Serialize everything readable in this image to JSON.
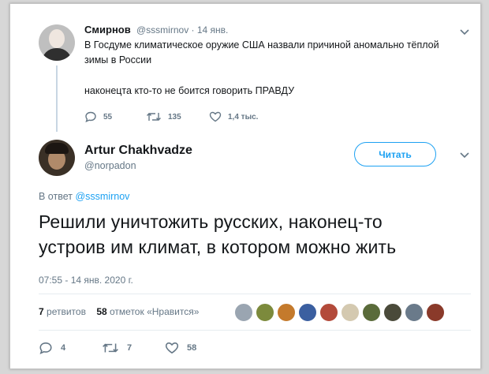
{
  "parent": {
    "name": "Смирнов",
    "handle_time": "@sssmirnov · 14 янв.",
    "text_line1": "В Госдуме климатическое оружие США назвали причиной аномально тёплой",
    "text_line2": "зимы в России",
    "text_line3": "наконецта кто-то не боится говорить ПРАВДУ",
    "replies": "55",
    "retweets": "135",
    "likes": "1,4 тыс."
  },
  "tweet": {
    "name": "Artur Chakhvadze",
    "handle": "@norpadon",
    "follow_label": "Читать",
    "reply_prefix": "В ответ",
    "reply_to": "@sssmirnov",
    "text_line1": "Решили уничтожить русских, наконец-то",
    "text_line2": "устроив им климат, в котором можно жить",
    "timestamp": "07:55 - 14 янв. 2020 г.",
    "retweets_count": "7",
    "retweets_label": "ретвитов",
    "likes_count": "58",
    "likes_label": "отметок «Нравится»",
    "replies": "4",
    "retweets": "7",
    "likes": "58",
    "liker_colors": [
      "#9aa5b1",
      "#7c8a3c",
      "#c47a2c",
      "#3b5fa0",
      "#b34a3a",
      "#d4c9b0",
      "#5a6b3a",
      "#4a4a3a",
      "#6a7a8a",
      "#8a3a2a"
    ]
  },
  "accent_color": "#1da1f2"
}
